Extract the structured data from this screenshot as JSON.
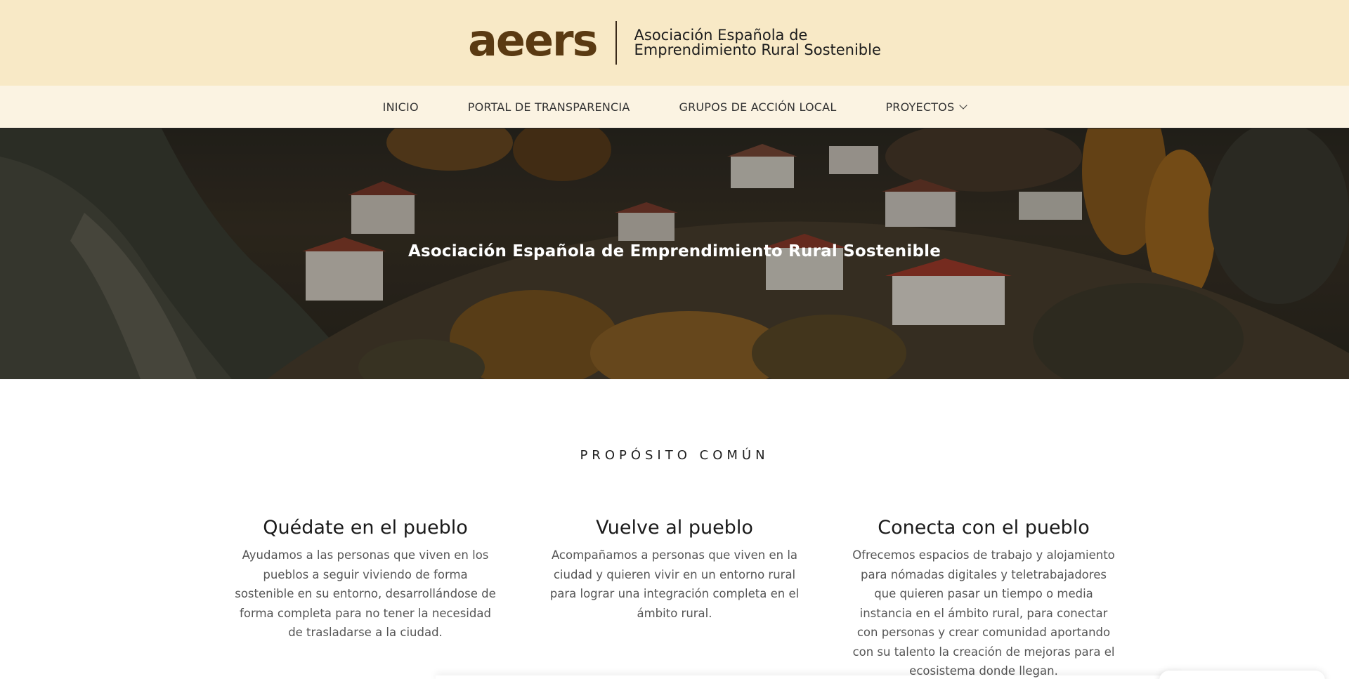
{
  "header": {
    "logo_text": "aeers",
    "org_name_line1": "Asociación Española de",
    "org_name_line2": "Emprendimiento Rural Sostenible"
  },
  "nav": {
    "items": [
      {
        "label": "INICIO"
      },
      {
        "label": "PORTAL DE TRANSPARENCIA"
      },
      {
        "label": "GRUPOS DE ACCIÓN LOCAL"
      },
      {
        "label": "PROYECTOS",
        "has_dropdown": true
      }
    ]
  },
  "hero": {
    "title": "Asociación Española de Emprendimiento Rural Sostenible"
  },
  "purpose": {
    "section_label": "PROPÓSITO COMÚN",
    "columns": [
      {
        "title": "Quédate en el pueblo",
        "text": "Ayudamos a las personas que viven en los pueblos a seguir viviendo de forma sostenible en su entorno, desarrollándose de forma completa para no tener la necesidad de trasladarse a la ciudad."
      },
      {
        "title": "Vuelve al pueblo",
        "text": "Acompañamos a personas que viven en la ciudad y quieren vivir en un entorno rural para lograr una integración completa en el ámbito rural."
      },
      {
        "title": "Conecta con el pueblo",
        "text": "Ofrecemos espacios de trabajo y alojamiento para nómadas digitales y teletrabajadores que quieren pasar un tiempo o media instancia en el ámbito rural, para conectar con personas y crear comunidad aportando con su talento la creación de mejoras para el ecosistema donde llegan."
      }
    ]
  },
  "colors": {
    "header_bg": "#f8e9c6",
    "nav_bg": "#fbf3e2",
    "logo": "#5a3a12"
  }
}
